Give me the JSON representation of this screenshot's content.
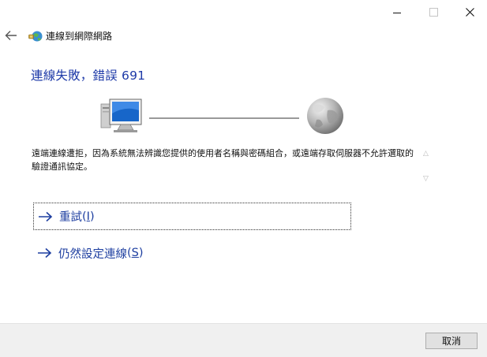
{
  "window": {
    "title": "連線到網際網路"
  },
  "error": {
    "heading": "連線失敗，錯誤 691",
    "message": "遠端連線遭拒，因為系統無法辨識您提供的使用者名稱與密碼組合，或遠端存取伺服器不允許選取的驗證通訊協定。"
  },
  "actions": {
    "retry_label": "重試",
    "retry_key": "I",
    "setup_label": "仍然設定連線",
    "setup_key": "S"
  },
  "footer": {
    "cancel_label": "取消"
  },
  "colors": {
    "heading": "#1e3aa8",
    "link": "#1d3ea0",
    "footer_bg": "#f0f0f0"
  },
  "icons": {
    "back": "back-arrow-icon",
    "app": "network-connection-icon",
    "computer": "computer-icon",
    "internet": "globe-icon",
    "link_arrow": "right-arrow-icon"
  }
}
